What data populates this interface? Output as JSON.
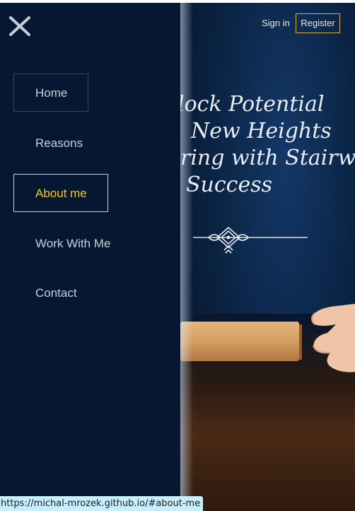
{
  "header": {
    "sign_in_label": "Sign in",
    "register_label": "Register",
    "accent_color": "#d8b13c"
  },
  "menu": {
    "close_icon": "close-icon",
    "items": [
      {
        "label": "Home",
        "state": "boxed"
      },
      {
        "label": "Reasons",
        "state": "plain"
      },
      {
        "label": "About me",
        "state": "active"
      },
      {
        "label": "Work With Me",
        "state": "plain"
      },
      {
        "label": "Contact",
        "state": "plain"
      }
    ],
    "active_color": "#f3c81c"
  },
  "hero": {
    "headline_lines": [
      "lock Potential",
      "New Heights",
      "ring with Stairway",
      "Success"
    ],
    "ornament_icon": "ornament-divider-icon"
  },
  "status_bar": {
    "url": "https://michal-mrozek.github.io/#about-me"
  }
}
